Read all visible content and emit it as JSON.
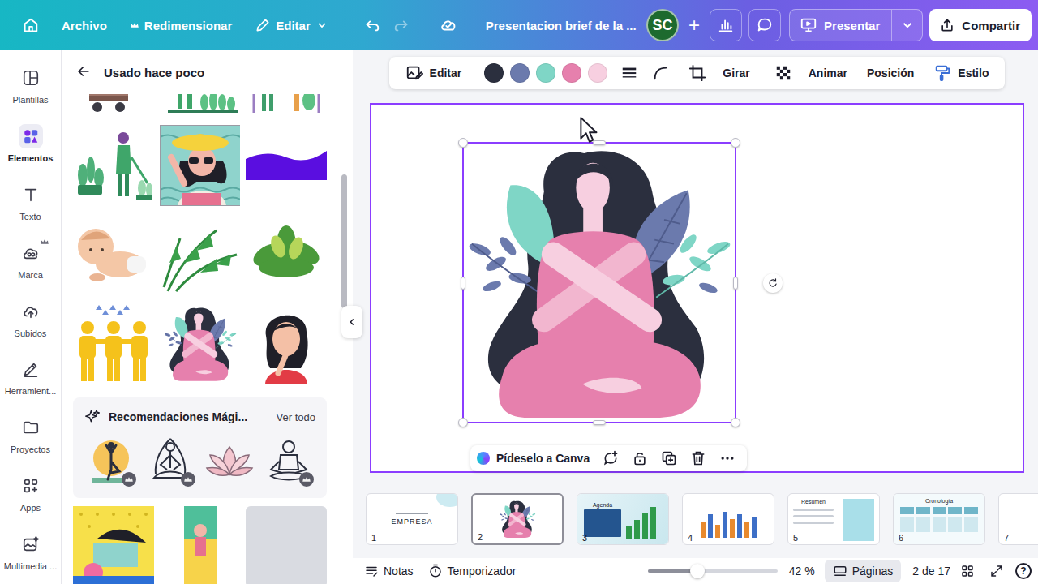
{
  "topbar": {
    "menu": [
      {
        "label": "Archivo",
        "premium": false
      },
      {
        "label": "Redimensionar",
        "premium": true
      },
      {
        "label": "Editar",
        "premium": false
      }
    ],
    "undo": {
      "disabled": false
    },
    "redo": {
      "disabled": true
    },
    "title": "Presentacion brief de la ...",
    "avatar": "SC",
    "add": "+",
    "present": "Presentar",
    "share": "Compartir"
  },
  "rail": [
    {
      "label": "Plantillas",
      "selected": false,
      "premium": false
    },
    {
      "label": "Elementos",
      "selected": true,
      "premium": false
    },
    {
      "label": "Texto",
      "selected": false,
      "premium": false
    },
    {
      "label": "Marca",
      "selected": false,
      "premium": true
    },
    {
      "label": "Subidos",
      "selected": false,
      "premium": false
    },
    {
      "label": "Herramient...",
      "selected": false,
      "premium": false
    },
    {
      "label": "Proyectos",
      "selected": false,
      "premium": false
    },
    {
      "label": "Apps",
      "selected": false,
      "premium": false
    },
    {
      "label": "Multimedia ...",
      "selected": false,
      "premium": false
    }
  ],
  "panel": {
    "title": "Usado hace poco",
    "magic": {
      "title": "Recomendaciones Mági...",
      "link": "Ver todo",
      "items": [
        {
          "premium": true
        },
        {
          "premium": true
        },
        {
          "premium": false
        },
        {
          "premium": true
        }
      ]
    }
  },
  "toolbar": {
    "edit": "Editar",
    "swatches": [
      {
        "color": "#2b2f3e"
      },
      {
        "color": "#6b7aad"
      },
      {
        "color": "#7fd6c6"
      },
      {
        "color": "#e680ad"
      },
      {
        "color": "#f7cfe0"
      }
    ],
    "rotate": "Girar",
    "animate": "Animar",
    "position": "Posición",
    "style": "Estilo"
  },
  "canvas": {
    "ask": "Pídeselo a Canva"
  },
  "pages": [
    {
      "number": "1",
      "selected": false,
      "kind": "title",
      "text": "EMPRESA",
      "values": []
    },
    {
      "number": "2",
      "selected": true,
      "kind": "illustration",
      "text": "",
      "values": []
    },
    {
      "number": "3",
      "selected": false,
      "kind": "agenda",
      "text": "Agenda",
      "values": [
        4,
        6,
        8,
        10
      ]
    },
    {
      "number": "4",
      "selected": false,
      "kind": "chart",
      "text": "",
      "values": [
        6,
        9,
        5,
        10,
        7,
        9,
        6,
        8
      ]
    },
    {
      "number": "5",
      "selected": false,
      "kind": "summary",
      "text": "Resumen",
      "values": []
    },
    {
      "number": "6",
      "selected": false,
      "kind": "timeline",
      "text": "Cronología",
      "values": []
    },
    {
      "number": "7",
      "selected": false,
      "kind": "blank",
      "text": "",
      "values": []
    }
  ],
  "status_bar": {
    "notes": "Notas",
    "timer": "Temporizador",
    "zoom": {
      "level": 0.38,
      "reading": "42 %"
    },
    "pages_button": "Páginas",
    "page_count": "2 de 17",
    "help": "?"
  }
}
